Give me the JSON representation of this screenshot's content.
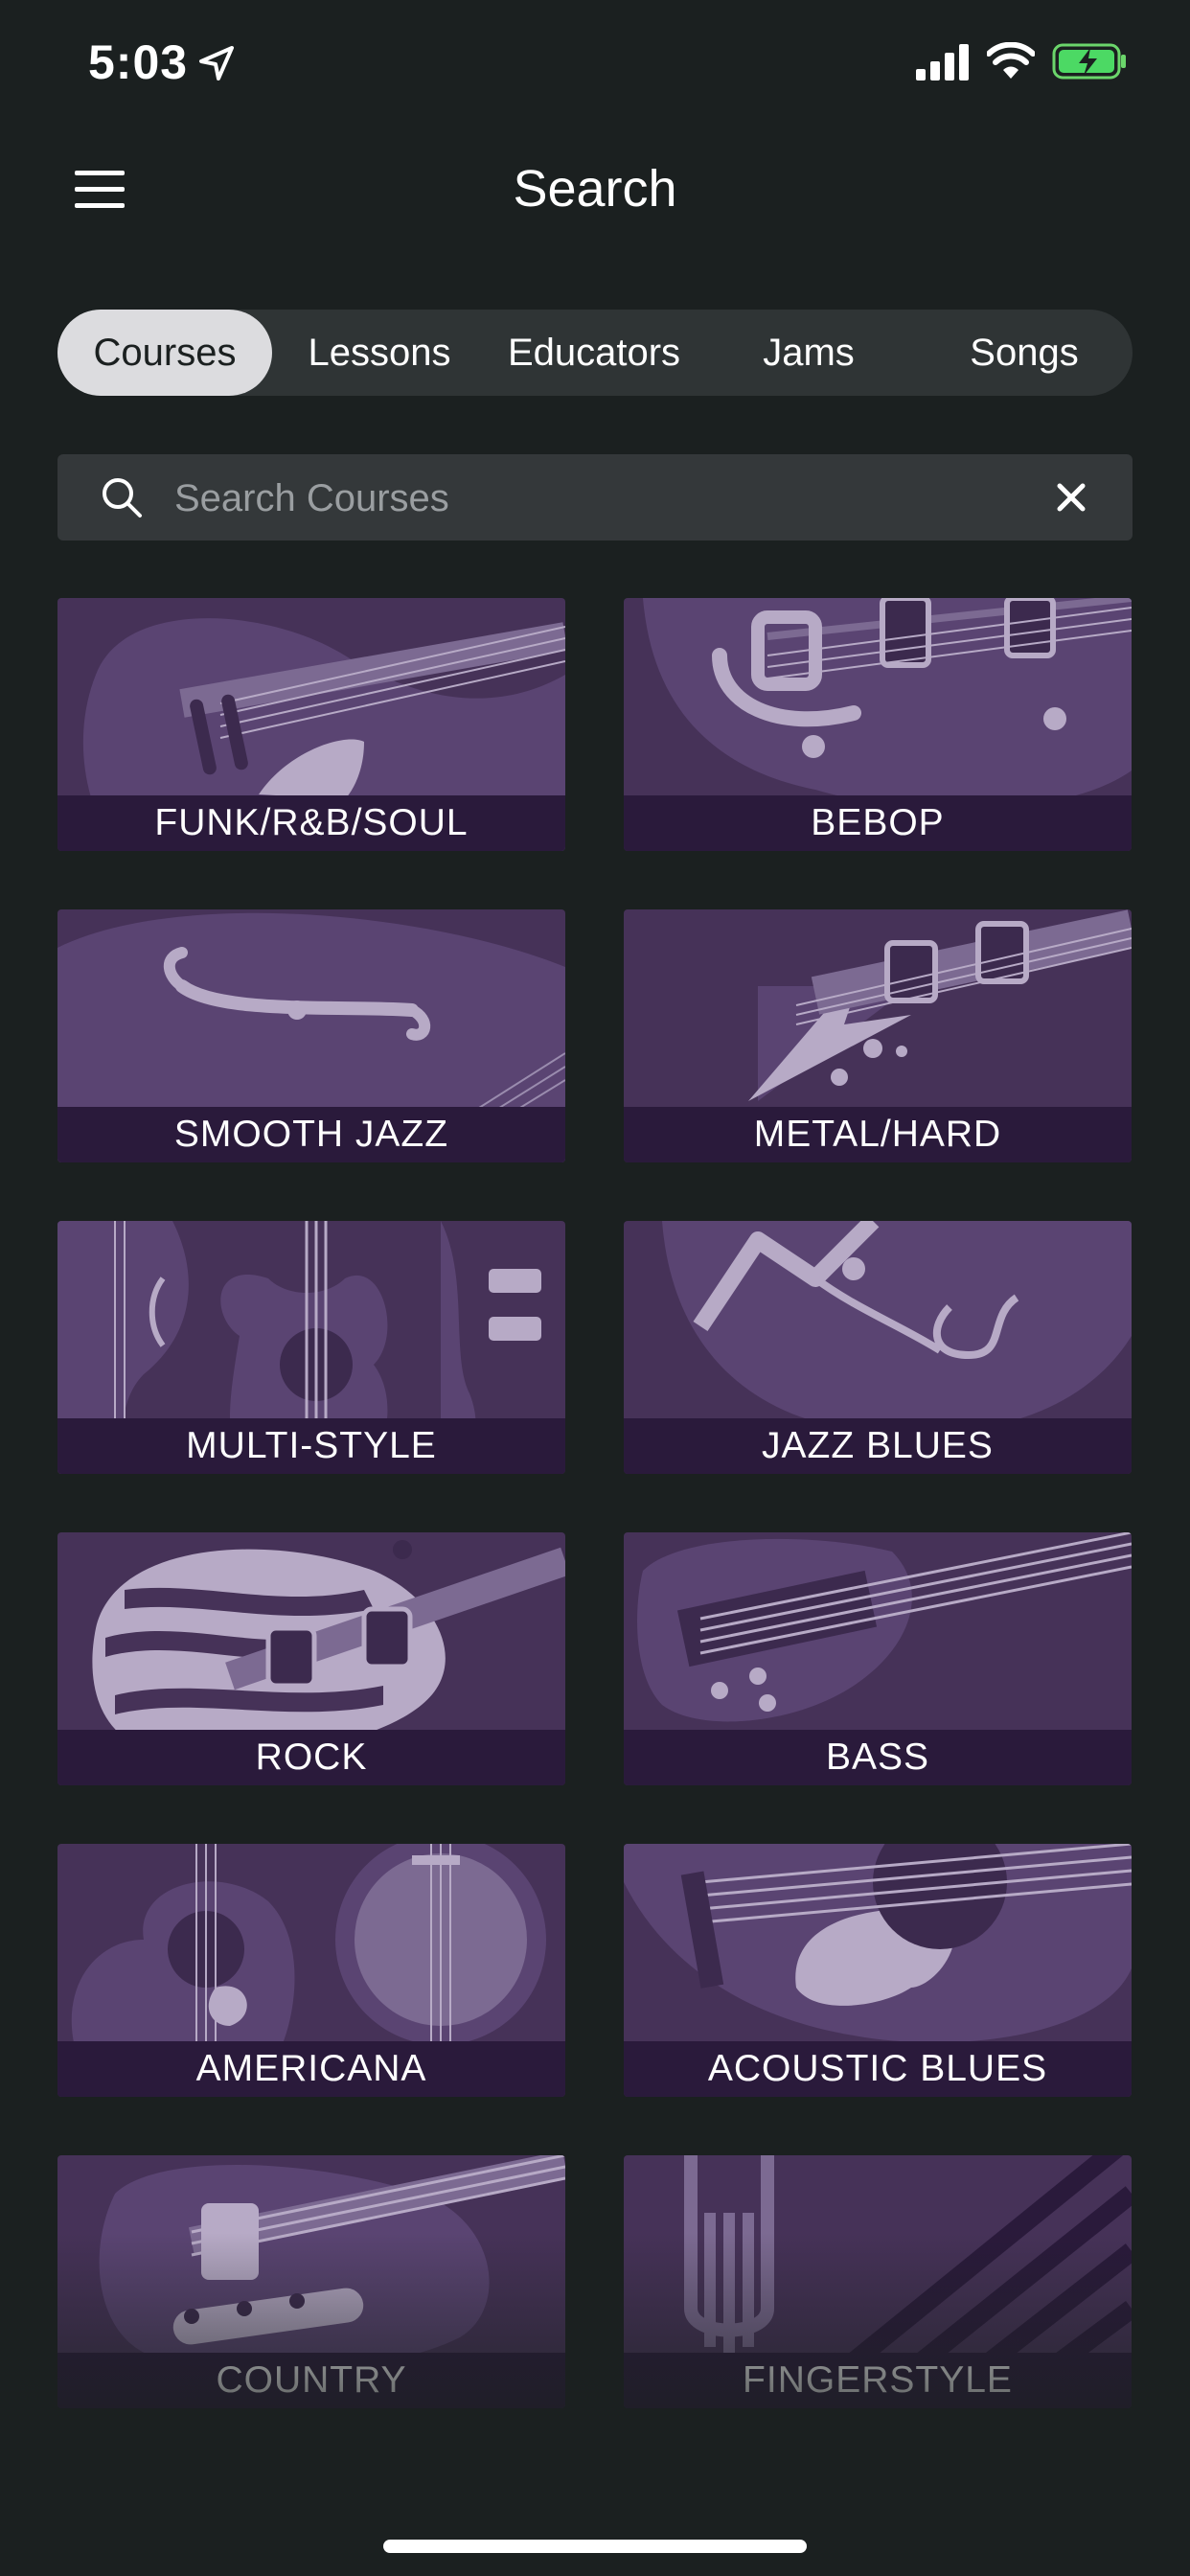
{
  "status": {
    "time": "5:03"
  },
  "header": {
    "title": "Search"
  },
  "tabs": [
    {
      "label": "Courses",
      "active": true
    },
    {
      "label": "Lessons",
      "active": false
    },
    {
      "label": "Educators",
      "active": false
    },
    {
      "label": "Jams",
      "active": false
    },
    {
      "label": "Songs",
      "active": false
    }
  ],
  "search": {
    "placeholder": "Search Courses",
    "value": ""
  },
  "categories": [
    {
      "label": "FUNK/R&B/SOUL",
      "icon": "guitar-body-art"
    },
    {
      "label": "BEBOP",
      "icon": "archtop-guitar-art"
    },
    {
      "label": "SMOOTH JAZZ",
      "icon": "f-hole-guitar-art"
    },
    {
      "label": "METAL/HARD",
      "icon": "flying-v-guitar-art"
    },
    {
      "label": "MULTI-STYLE",
      "icon": "multi-guitar-art"
    },
    {
      "label": "JAZZ BLUES",
      "icon": "jazz-guitar-art"
    },
    {
      "label": "ROCK",
      "icon": "zebra-guitar-art"
    },
    {
      "label": "BASS",
      "icon": "bass-guitar-art"
    },
    {
      "label": "AMERICANA",
      "icon": "banjo-guitar-art"
    },
    {
      "label": "ACOUSTIC BLUES",
      "icon": "pickguard-guitar-art"
    },
    {
      "label": "COUNTRY",
      "icon": "telecaster-art"
    },
    {
      "label": "FINGERSTYLE",
      "icon": "hand-stripes-art"
    }
  ],
  "colors": {
    "background": "#1b2020",
    "tile": "#463258",
    "tile_label_bg": "#2a1a3b",
    "active_tab": "#dcdcdf"
  }
}
